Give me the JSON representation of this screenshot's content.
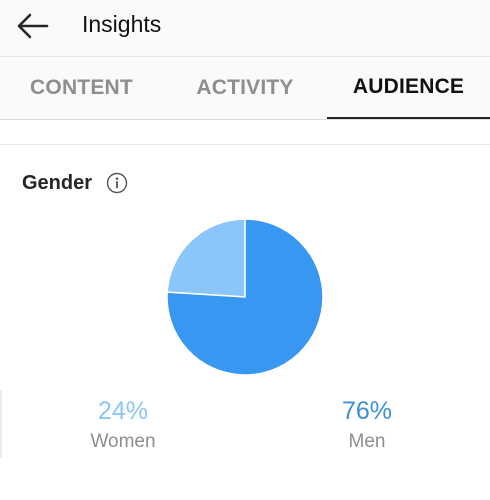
{
  "header": {
    "title": "Insights",
    "back_icon": "arrow-left-icon"
  },
  "tabs": [
    {
      "label": "CONTENT",
      "active": false
    },
    {
      "label": "ACTIVITY",
      "active": false
    },
    {
      "label": "AUDIENCE",
      "active": true
    }
  ],
  "section": {
    "title": "Gender",
    "info_icon": "info-icon"
  },
  "colors": {
    "women": "#8ac5fb",
    "men": "#3897f0",
    "women_text": "#8ac5fb",
    "men_text": "#3d8fd6"
  },
  "chart_data": {
    "type": "pie",
    "categories": [
      "Women",
      "Men"
    ],
    "values": [
      24,
      76
    ],
    "value_labels": [
      "24%",
      "76%"
    ]
  }
}
